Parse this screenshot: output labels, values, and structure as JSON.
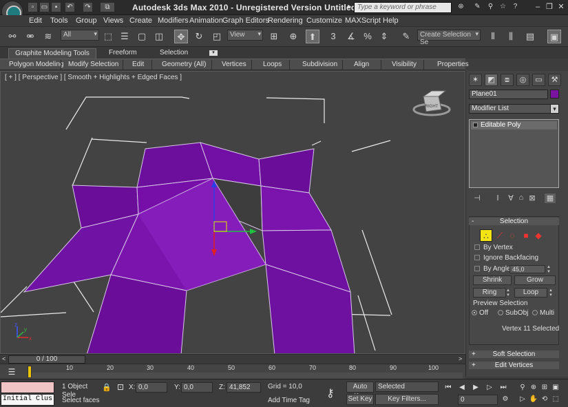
{
  "window": {
    "title": "Autodesk 3ds Max  2010  - Unregistered Version   Untitled",
    "search_placeholder": "Type a keyword or phrase",
    "minimize": "–",
    "restore": "❐",
    "close": "✕"
  },
  "menu": [
    "Edit",
    "Tools",
    "Group",
    "Views",
    "Create",
    "Modifiers",
    "Animation",
    "Graph Editors",
    "Rendering",
    "Customize",
    "MAXScript",
    "Help"
  ],
  "toolbar": {
    "selection_filter": "All",
    "ref_coord": "View",
    "named_selection": "Create Selection Se"
  },
  "ribbon": {
    "tabs": [
      "Graphite Modeling Tools",
      "Freeform",
      "Selection"
    ],
    "panels": [
      "Polygon Modeling",
      "Modify Selection",
      "Edit",
      "Geometry (All)",
      "Vertices",
      "Loops",
      "Subdivision",
      "Align",
      "Visibility",
      "Properties"
    ]
  },
  "viewport": {
    "label": "[ + ] [ Perspective ] [ Smooth + Highlights + Edged Faces ]",
    "viewcube_label": "RIGHT",
    "mesh_color": "#6a0d9a",
    "axis_x": "x",
    "axis_y": "y",
    "axis_z": "z"
  },
  "command_panel": {
    "object_name": "Plane01",
    "object_color": "#7a14a0",
    "modifier_list": "Modifier List",
    "stack_item": "Editable Poly",
    "selection_title": "Selection",
    "by_vertex": "By Vertex",
    "ignore_backfacing": "Ignore Backfacing",
    "by_angle": "By Angle:",
    "by_angle_value": "45,0",
    "shrink": "Shrink",
    "grow": "Grow",
    "ring": "Ring",
    "loop": "Loop",
    "preview_selection": "Preview Selection",
    "preview_off": "Off",
    "preview_subobj": "SubObj",
    "preview_multi": "Multi",
    "selected_status": "Vertex 11 Selected",
    "soft_selection": "Soft Selection",
    "edit_vertices": "Edit Vertices",
    "rollout_open": "-",
    "rollout_closed": "+"
  },
  "timeline": {
    "frame_display": "0 / 100",
    "ticks": [
      "10",
      "20",
      "30",
      "40",
      "50",
      "60",
      "70",
      "80",
      "90",
      "100"
    ]
  },
  "status": {
    "maxscript_text": "Initial Clus",
    "selected_count": "1 Object Sele",
    "prompt": "Select faces",
    "x_label": "X:",
    "x_value": "0,0",
    "y_label": "Y:",
    "y_value": "0,0",
    "z_label": "Z:",
    "z_value": "41,852",
    "grid": "Grid = 10,0",
    "add_time_tag": "Add Time Tag",
    "auto_key": "Auto Key",
    "set_key": "Set Key",
    "key_mode": "Selected",
    "key_filters": "Key Filters...",
    "current_frame": "0"
  }
}
